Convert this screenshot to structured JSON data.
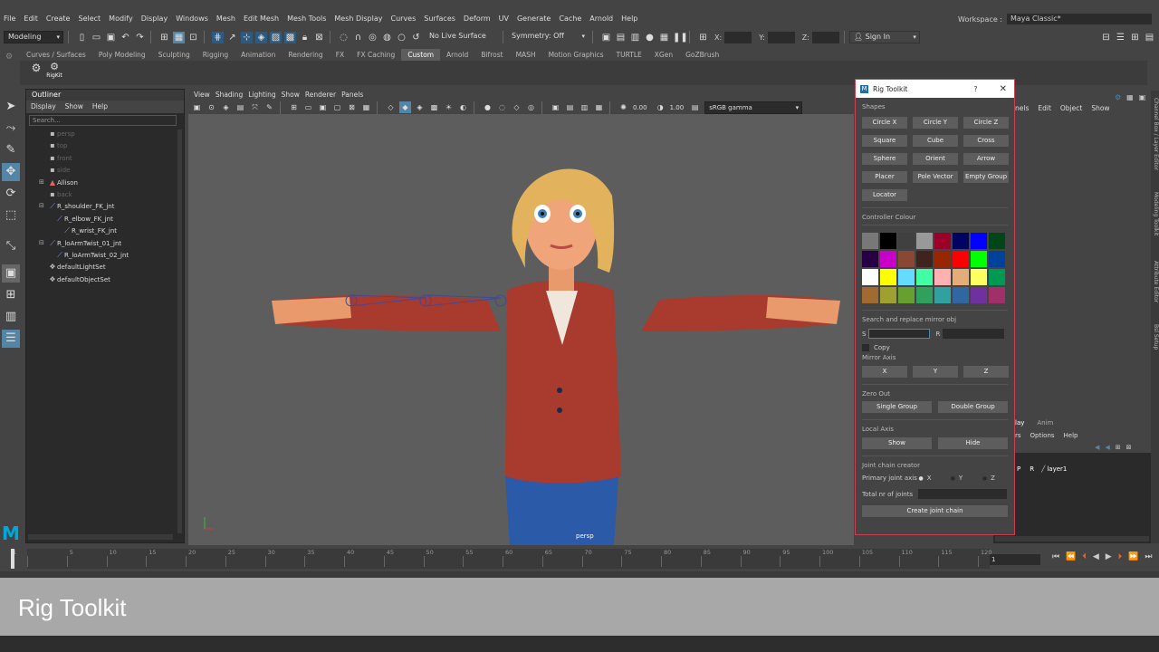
{
  "menubar": {
    "items": [
      "File",
      "Edit",
      "Create",
      "Select",
      "Modify",
      "Display",
      "Windows",
      "Mesh",
      "Edit Mesh",
      "Mesh Tools",
      "Mesh Display",
      "Curves",
      "Surfaces",
      "Deform",
      "UV",
      "Generate",
      "Cache",
      "Arnold",
      "Help"
    ],
    "workspace_label": "Workspace :",
    "workspace_value": "Maya Classic*"
  },
  "statusline": {
    "mode": "Modeling",
    "live_surface": "No Live Surface",
    "symmetry": "Symmetry: Off",
    "x_label": "X:",
    "y_label": "Y:",
    "z_label": "Z:",
    "sign_in": "Sign In"
  },
  "shelf": {
    "tabs": [
      "Curves / Surfaces",
      "Poly Modeling",
      "Sculpting",
      "Rigging",
      "Animation",
      "Rendering",
      "FX",
      "FX Caching",
      "Custom",
      "Arnold",
      "Bifrost",
      "MASH",
      "Motion Graphics",
      "TURTLE",
      "XGen",
      "GoZBrush"
    ],
    "active_tab": "Custom",
    "rigkit_label": "RigKit"
  },
  "outliner": {
    "title": "Outliner",
    "menu": [
      "Display",
      "Show",
      "Help"
    ],
    "search_placeholder": "Search...",
    "items": [
      {
        "label": "persp",
        "dim": true,
        "indent": 0
      },
      {
        "label": "top",
        "dim": true,
        "indent": 0
      },
      {
        "label": "front",
        "dim": true,
        "indent": 0
      },
      {
        "label": "side",
        "dim": true,
        "indent": 0
      },
      {
        "label": "Allison",
        "dim": false,
        "indent": 0
      },
      {
        "label": "back",
        "dim": true,
        "indent": 0
      },
      {
        "label": "R_shoulder_FK_jnt",
        "dim": false,
        "indent": 0
      },
      {
        "label": "R_elbow_FK_jnt",
        "dim": false,
        "indent": 1
      },
      {
        "label": "R_wrist_FK_jnt",
        "dim": false,
        "indent": 2
      },
      {
        "label": "R_loArmTwist_01_jnt",
        "dim": false,
        "indent": 0
      },
      {
        "label": "R_loArmTwist_02_jnt",
        "dim": false,
        "indent": 1
      },
      {
        "label": "defaultLightSet",
        "dim": false,
        "indent": 0
      },
      {
        "label": "defaultObjectSet",
        "dim": false,
        "indent": 0
      }
    ]
  },
  "viewport": {
    "menu": [
      "View",
      "Shading",
      "Lighting",
      "Show",
      "Renderer",
      "Panels"
    ],
    "exposure": "0.00",
    "gamma": "1.00",
    "colorspace": "sRGB gamma",
    "camera_label": "persp"
  },
  "right_panel": {
    "menu": [
      "nels",
      "Edit",
      "Object",
      "Show"
    ],
    "layer_tabs": [
      "lay",
      "Anim"
    ],
    "layer_menu": [
      "rs",
      "Options",
      "Help"
    ],
    "layer_p": "P",
    "layer_r": "R",
    "layer_name": "layer1",
    "vertical_tabs": [
      "Channel Box / Layer Editor",
      "Modeling Toolkit",
      "Attribute Editor",
      "Bsl Setup"
    ]
  },
  "rig_toolkit": {
    "title": "Rig Toolkit",
    "help": "?",
    "shapes_label": "Shapes",
    "shapes": [
      "Circle X",
      "Circle Y",
      "Circle Z",
      "Square",
      "Cube",
      "Cross",
      "Sphere",
      "Orient",
      "Arrow",
      "Placer",
      "Pole Vector",
      "Empty Group",
      "Locator"
    ],
    "controller_colour_label": "Controller Colour",
    "colors": [
      "#787878",
      "#000000",
      "#404040",
      "#999999",
      "#9b0028",
      "#000460",
      "#0000ff",
      "#004619",
      "#260043",
      "#c800c8",
      "#8a4733",
      "#3f231f",
      "#992600",
      "#ff0000",
      "#00ff00",
      "#004199",
      "#ffffff",
      "#ffff00",
      "#64dcff",
      "#43ffa3",
      "#ffb0b0",
      "#e4ac79",
      "#ffff62",
      "#009954",
      "#a06a30",
      "#9ea030",
      "#68a030",
      "#30a15d",
      "#30a0a0",
      "#3067a0",
      "#6f30a0",
      "#a0306a"
    ],
    "search_replace_label": "Search and replace mirror obj",
    "s_label": "S",
    "r_label": "R",
    "copy_label": "Copy",
    "mirror_axis_label": "Mirror Axis",
    "mirror_axes": [
      "X",
      "Y",
      "Z"
    ],
    "zero_out_label": "Zero Out",
    "single_group": "Single Group",
    "double_group": "Double Group",
    "local_axis_label": "Local Axis",
    "show": "Show",
    "hide": "Hide",
    "joint_chain_label": "Joint chain creator",
    "primary_axis_label": "Primary joint axis",
    "primary_axes": [
      "X",
      "Y",
      "Z"
    ],
    "selected_axis": "X",
    "total_joints_label": "Total nr of joints",
    "create_chain": "Create joint chain"
  },
  "timeline": {
    "ticks": [
      "1",
      "5",
      "10",
      "15",
      "20",
      "25",
      "30",
      "35",
      "40",
      "45",
      "50",
      "55",
      "60",
      "65",
      "70",
      "75",
      "80",
      "85",
      "90",
      "95",
      "100",
      "105",
      "110",
      "115",
      "120"
    ],
    "current_frame": "1"
  },
  "caption": "Rig Toolkit",
  "colors": {
    "accent": "#5285a6",
    "window_border": "#c9404e"
  }
}
